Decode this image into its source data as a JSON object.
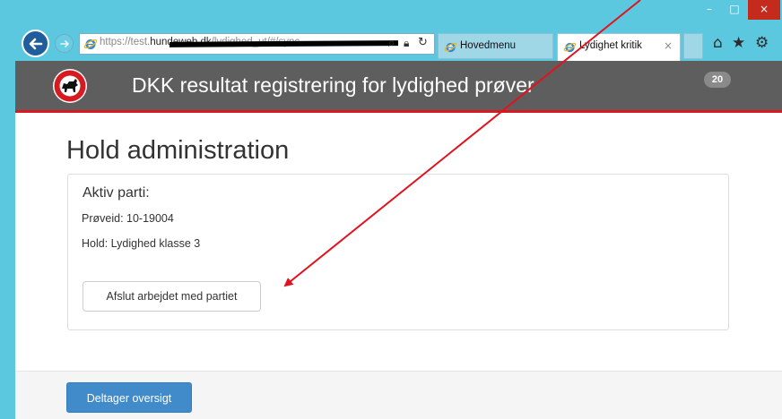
{
  "browser": {
    "window_controls": {
      "minimize": "–",
      "maximize": "□",
      "close": "×"
    },
    "nav": {
      "back_icon": "back-arrow-icon",
      "forward_icon": "forward-arrow-icon"
    },
    "address": {
      "url_prefix": "https://test.",
      "url_host": "hundeweb.dk",
      "url_path": "/lydighed_ut/#/sync",
      "icons": [
        "search-icon",
        "lock-icon",
        "refresh-icon"
      ]
    },
    "tabs": [
      {
        "label": "Hovedmenu",
        "active": false
      },
      {
        "label": "Lydighet kritik",
        "active": true,
        "close": "×"
      }
    ],
    "toolbar_icons": [
      "home-icon",
      "star-icon",
      "gear-icon"
    ]
  },
  "app": {
    "title": "DKK resultat registrering for lydighed prøver",
    "badge_count": "20",
    "colors": {
      "header_bg": "#5e5e5e",
      "header_border": "#d71920",
      "primary": "#428bca"
    }
  },
  "page": {
    "title": "Hold administration",
    "panel": {
      "heading": "Aktiv parti:",
      "line1": "Prøveid: 10-19004",
      "line2": "Hold: Lydighed klasse 3",
      "finish_button": "Afslut arbejdet med partiet"
    },
    "footer": {
      "overview_button": "Deltager oversigt"
    }
  },
  "annotation": {
    "arrow_color": "#e0131f"
  }
}
